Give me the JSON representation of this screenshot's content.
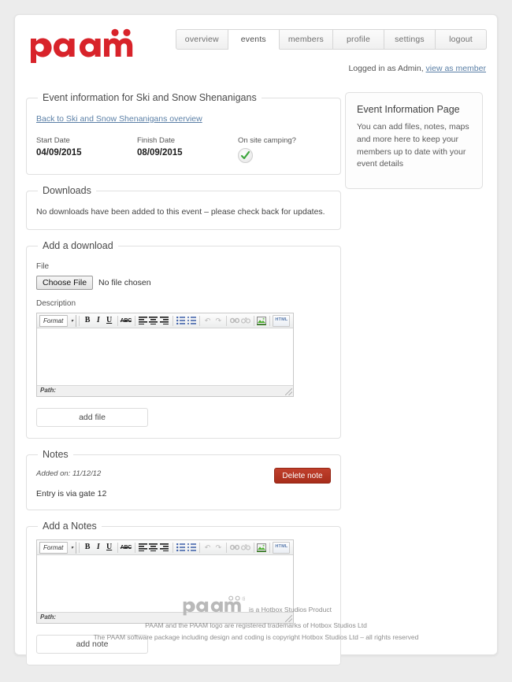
{
  "brand": {
    "logo_text": "paam",
    "logo_color": "#d8232a"
  },
  "nav": {
    "tabs": [
      {
        "label": "overview",
        "active": false
      },
      {
        "label": "events",
        "active": true
      },
      {
        "label": "members",
        "active": false
      },
      {
        "label": "profile",
        "active": false
      },
      {
        "label": "settings",
        "active": false
      },
      {
        "label": "logout",
        "active": false
      }
    ]
  },
  "session": {
    "logged_in_text": "Logged in as Admin,",
    "view_as_member_link": "view as member"
  },
  "event": {
    "legend": "Event information for Ski and Snow Shenanigans",
    "back_link": "Back to Ski and Snow Shenanigans overview",
    "start_date_label": "Start Date",
    "start_date_value": "04/09/2015",
    "finish_date_label": "Finish Date",
    "finish_date_value": "08/09/2015",
    "camping_label": "On site camping?",
    "camping_state": "yes"
  },
  "downloads": {
    "legend": "Downloads",
    "empty_text": "No downloads have been added to this event – please check back for updates."
  },
  "add_download": {
    "legend": "Add a download",
    "file_label": "File",
    "choose_file_button": "Choose File",
    "file_status": "No file chosen",
    "description_label": "Description",
    "submit_label": "add file"
  },
  "notes": {
    "legend": "Notes",
    "added_on": "Added on: 11/12/12",
    "delete_label": "Delete note",
    "entry_text": "Entry is via gate 12"
  },
  "add_note": {
    "legend": "Add a Notes",
    "submit_label": "add note"
  },
  "editor": {
    "format_label": "Format",
    "path_label": "Path:",
    "buttons": [
      {
        "name": "bold",
        "glyph": "B"
      },
      {
        "name": "italic",
        "glyph": "I"
      },
      {
        "name": "underline",
        "glyph": "U"
      },
      {
        "name": "strikethrough",
        "glyph": "ABC"
      },
      {
        "name": "align-left",
        "glyph": ""
      },
      {
        "name": "align-center",
        "glyph": ""
      },
      {
        "name": "align-right",
        "glyph": ""
      },
      {
        "name": "bullet-list",
        "glyph": ""
      },
      {
        "name": "numbered-list",
        "glyph": ""
      },
      {
        "name": "undo",
        "glyph": "↶"
      },
      {
        "name": "redo",
        "glyph": "↷"
      },
      {
        "name": "link",
        "glyph": ""
      },
      {
        "name": "unlink",
        "glyph": ""
      },
      {
        "name": "insert-image",
        "glyph": ""
      },
      {
        "name": "html-source",
        "glyph": "HTML"
      }
    ]
  },
  "sidebar": {
    "title": "Event Information Page",
    "text": "You can add files, notes, maps and more here to keep your members up to date with your event details"
  },
  "footer": {
    "logo_text": "paam",
    "registered_mark": "®",
    "tagline": "is a Hotbox Studios Product",
    "line2": "PAAM and the PAAM logo are registered trademarks of Hotbox Studios Ltd",
    "line3": "The PAAM software package including design and coding is copyright Hotbox Studios Ltd – all rights reserved"
  }
}
